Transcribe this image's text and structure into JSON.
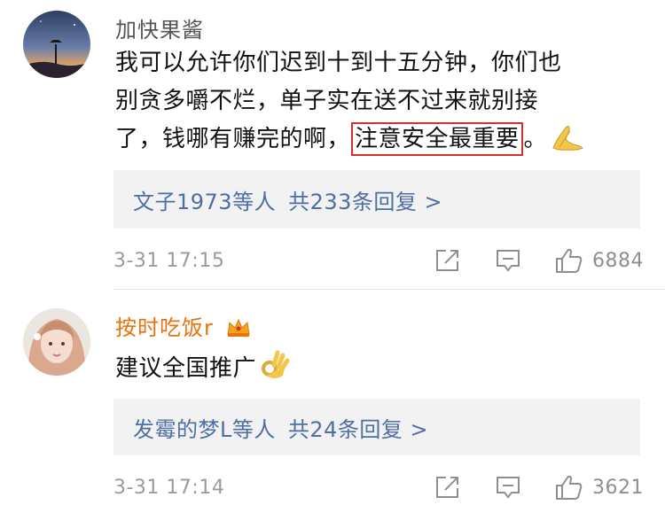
{
  "comments": [
    {
      "username": "加快果酱",
      "text_lines": [
        "我可以允许你们迟到十到十五分钟，你们也",
        "别贪多嚼不烂，单子实在送不过来就别接",
        "了，钱哪有赚完的啊，"
      ],
      "highlight": "注意安全最重要",
      "trailing": "。",
      "emoji": "folded-hands-emoji",
      "replies": {
        "users": "文子1973等人",
        "total": "共233条回复 >"
      },
      "time": "3-31 17:15",
      "likes": "6884",
      "colors": {
        "username": "#555555"
      }
    },
    {
      "username": "按时吃饭r",
      "badge": "crown-badge-icon",
      "text": "建议全国推广",
      "emoji": "ok-hand-emoji",
      "replies": {
        "users": "发霉的梦L等人",
        "total": "共24条回复 >"
      },
      "time": "3-31 17:14",
      "likes": "3621",
      "colors": {
        "username": "#e8730c"
      }
    }
  ],
  "colors": {
    "link": "#4d6fa3",
    "highlight_border": "#d6302b",
    "reply_bg": "#f2f2f2",
    "meta": "#9b9b9b"
  }
}
